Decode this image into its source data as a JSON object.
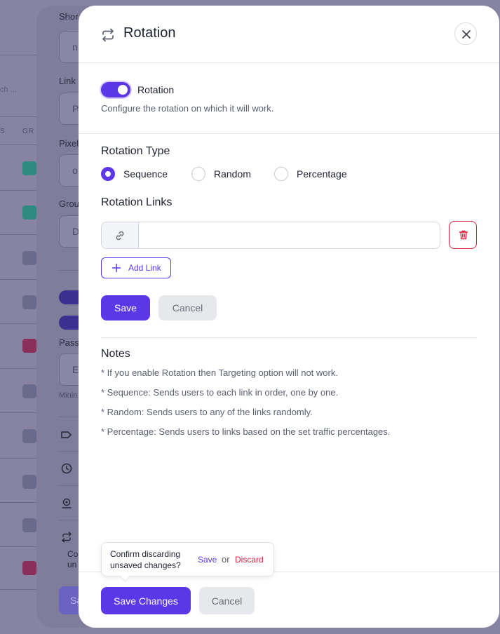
{
  "background": {
    "labels": [
      "Shor",
      "Link",
      "Pixel",
      "Grou",
      "Pass"
    ],
    "search_placeholder": "ch ...",
    "col_headers": [
      "S",
      "GR"
    ],
    "input_fragments": [
      "n",
      "P",
      "o",
      "D",
      "Er"
    ],
    "hint_text": "Minin",
    "tooltip_fragment_1": "Co",
    "tooltip_fragment_2": "un",
    "button_fragment": "Sa",
    "dot_colors": [
      "#2f8a7f",
      "#2f8a7f",
      "#6a6a8c",
      "#6a6a8c",
      "#8a2f5a",
      "#6a6a8c",
      "#6a6a8c",
      "#6a6a8c",
      "#6a6a8c",
      "#8a2f5a"
    ]
  },
  "modal": {
    "title": "Rotation",
    "header_icon": "rotation-icon",
    "close_icon": "close-icon",
    "toggle": {
      "label": "Rotation",
      "enabled": true,
      "description": "Configure the rotation on which it will work."
    },
    "rotation_type": {
      "title": "Rotation Type",
      "options": [
        "Sequence",
        "Random",
        "Percentage"
      ],
      "selected": "Sequence"
    },
    "rotation_links": {
      "title": "Rotation Links",
      "link_value": "",
      "link_icon": "link-icon",
      "delete_icon": "trash-icon",
      "add_label": "Add Link"
    },
    "actions": {
      "save_label": "Save",
      "cancel_label": "Cancel"
    },
    "notes": {
      "title": "Notes",
      "items": [
        "* If you enable Rotation then Targeting option will not work.",
        "* Sequence: Sends users to each link in order, one by one.",
        "* Random: Sends users to any of the links randomly.",
        "* Percentage: Sends users to links based on the set traffic percentages."
      ]
    },
    "footer": {
      "save_changes_label": "Save Changes",
      "cancel_label": "Cancel"
    },
    "confirm_tooltip": {
      "text": "Confirm discarding unsaved changes?",
      "save_label": "Save",
      "or_label": "or",
      "discard_label": "Discard"
    }
  },
  "colors": {
    "accent": "#5b37e8",
    "danger": "#d8223f"
  }
}
